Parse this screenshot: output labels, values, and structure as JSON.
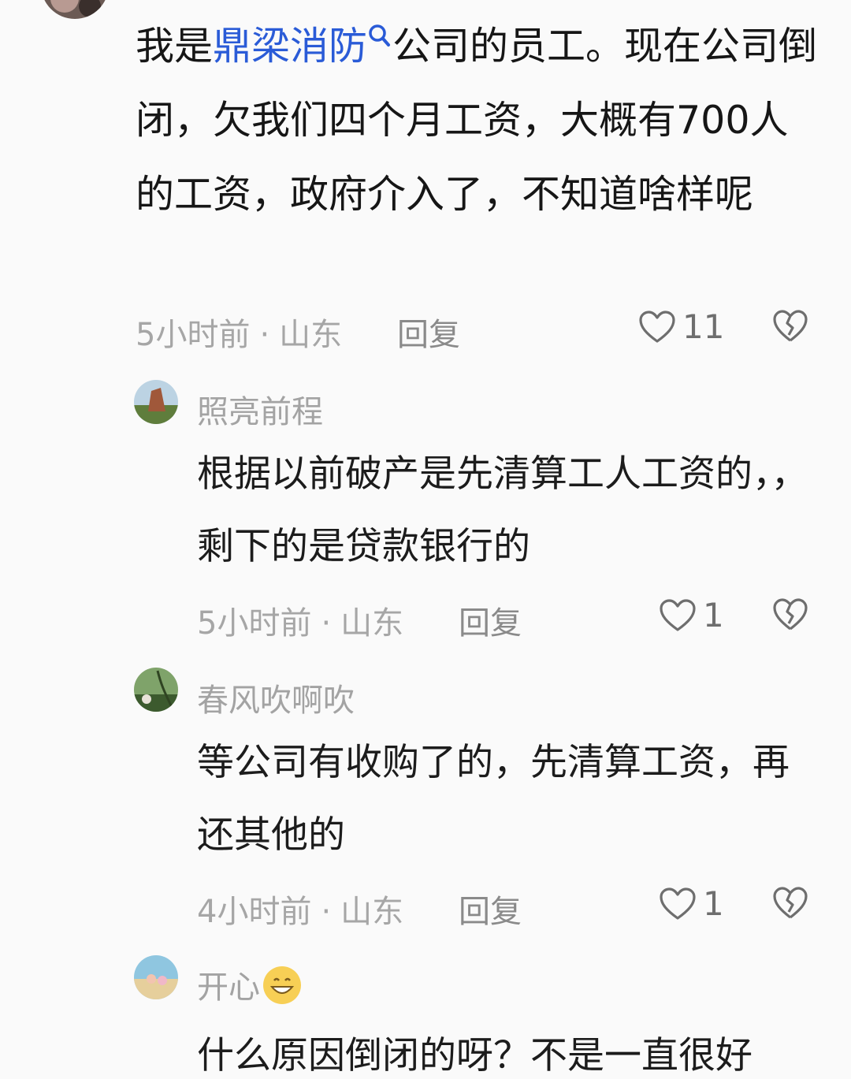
{
  "main_comment": {
    "text_before": "我是",
    "keyword": "鼎梁消防",
    "keyword_icon": "search-icon",
    "text_after": "公司的员工。现在公司倒闭，欠我们四个月工资，大概有700人的工资，政府介入了，不知道啥样呢",
    "time": "5小时前",
    "location": "山东",
    "reply_label": "回复",
    "likes": "11"
  },
  "replies": [
    {
      "username": "照亮前程",
      "text": "根据以前破产是先清算工人工资的，，剩下的是贷款银行的",
      "time": "5小时前",
      "location": "山东",
      "reply_label": "回复",
      "likes": "1"
    },
    {
      "username": "春风吹啊吹",
      "text": "等公司有收购了的，先清算工资，再还其他的",
      "time": "4小时前",
      "location": "山东",
      "reply_label": "回复",
      "likes": "1"
    },
    {
      "username": "开心",
      "username_emoji": "grinning-face-emoji",
      "text": "什么原因倒闭的呀？不是一直很好"
    }
  ],
  "separator": "·",
  "colors": {
    "keyword": "#2a5bd7",
    "meta": "#a6a6a6",
    "background": "#fafafa"
  }
}
